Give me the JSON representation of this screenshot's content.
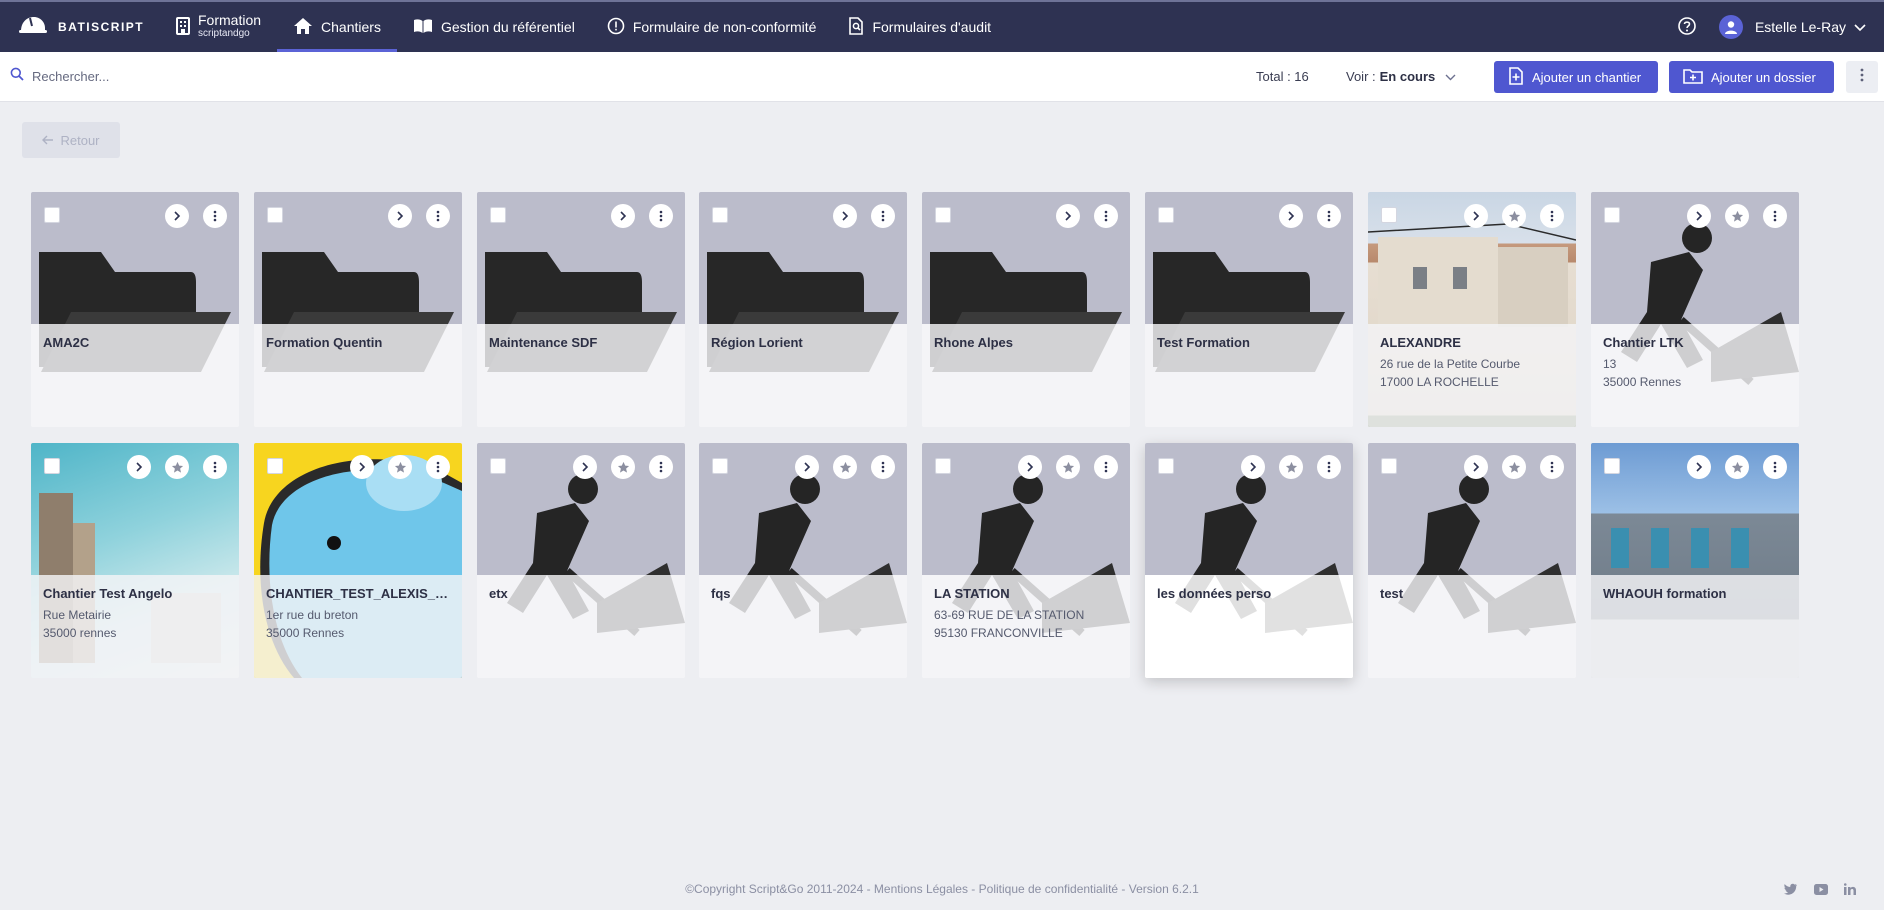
{
  "app": {
    "brand": "BATISCRIPT",
    "nav": [
      {
        "label": "Formation",
        "sub": "scriptandgo",
        "icon": "building-icon"
      },
      {
        "label": "Chantiers",
        "icon": "home-icon",
        "active": true
      },
      {
        "label": "Gestion du référentiel",
        "icon": "book-icon"
      },
      {
        "label": "Formulaire de non-conformité",
        "icon": "alert-circle-icon"
      },
      {
        "label": "Formulaires d'audit",
        "icon": "document-search-icon"
      }
    ],
    "user": {
      "name": "Estelle Le-Ray"
    },
    "colors": {
      "nav_bg": "#2e3252",
      "accent": "#4f57d0",
      "page_bg": "#edeef2"
    }
  },
  "toolbar": {
    "search_placeholder": "Rechercher...",
    "total_label": "Total : 16",
    "voir_label": "Voir :",
    "voir_value": "En cours",
    "add_chantier": "Ajouter un chantier",
    "add_dossier": "Ajouter un dossier"
  },
  "back_label": "Retour",
  "folders": [
    {
      "title": "AMA2C"
    },
    {
      "title": "Formation Quentin"
    },
    {
      "title": "Maintenance SDF"
    },
    {
      "title": "Région Lorient"
    },
    {
      "title": "Rhone Alpes"
    },
    {
      "title": "Test Formation"
    }
  ],
  "chantiers": [
    {
      "title": "ALEXANDRE",
      "line1": "26 rue de la Petite Courbe",
      "line2": "17000 LA ROCHELLE",
      "image": "house-photo"
    },
    {
      "title": "Chantier LTK",
      "line1": "13",
      "line2": "35000 Rennes",
      "image": "worker-icon"
    },
    {
      "title": "Chantier Test Angelo",
      "line1": "Rue Metairie",
      "line2": "35000 rennes",
      "image": "tower-photo"
    },
    {
      "title": "CHANTIER_TEST_ALEXIS_ES...",
      "line1": "1er rue du breton",
      "line2": "35000 Rennes",
      "image": "blob-illustration"
    },
    {
      "title": "etx",
      "line1": "",
      "line2": "",
      "image": "worker-icon"
    },
    {
      "title": "fqs",
      "line1": "",
      "line2": "",
      "image": "worker-icon"
    },
    {
      "title": "LA STATION",
      "line1": "63-69 RUE DE LA STATION",
      "line2": "95130 FRANCONVILLE",
      "image": "worker-icon"
    },
    {
      "title": "les données perso",
      "line1": "",
      "line2": "",
      "image": "worker-icon"
    },
    {
      "title": "test",
      "line1": "",
      "line2": "",
      "image": "worker-icon"
    },
    {
      "title": "WHAOUH formation",
      "line1": "",
      "line2": "",
      "image": "warehouse-photo"
    }
  ],
  "footer": {
    "text": "©Copyright Script&Go 2011-2024 - Mentions Légales - Politique de confidentialité - Version 6.2.1",
    "social": [
      "twitter-icon",
      "youtube-icon",
      "linkedin-icon"
    ]
  }
}
